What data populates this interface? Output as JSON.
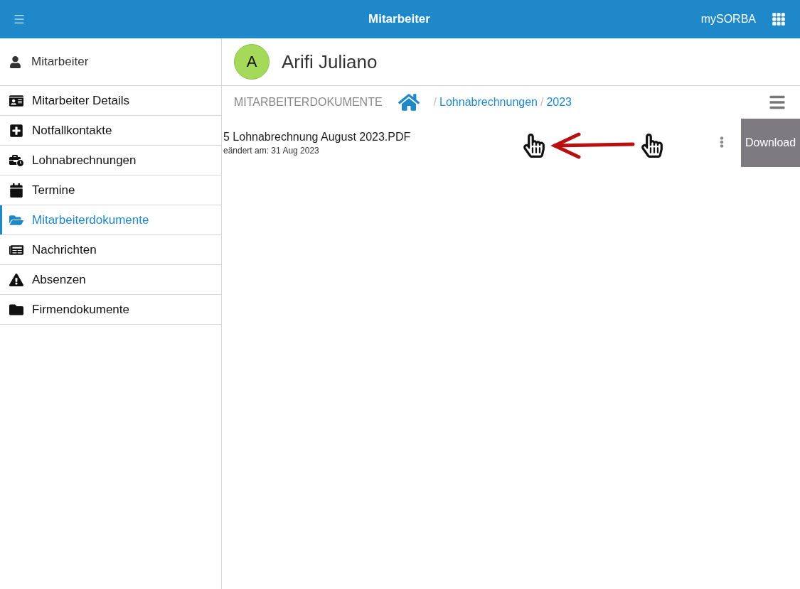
{
  "top_bar": {
    "title": "Mitarbeiter",
    "brand": "mySORBA"
  },
  "sidebar": {
    "header": "Mitarbeiter",
    "items": [
      {
        "label": "Mitarbeiter Details",
        "selected": false
      },
      {
        "label": "Notfallkontakte",
        "selected": false
      },
      {
        "label": "Lohnabrechnungen",
        "selected": false
      },
      {
        "label": "Termine",
        "selected": false
      },
      {
        "label": "Mitarbeiterdokumente",
        "selected": true
      },
      {
        "label": "Nachrichten",
        "selected": false
      },
      {
        "label": "Absenzen",
        "selected": false
      },
      {
        "label": "Firmendokumente",
        "selected": false
      }
    ]
  },
  "employee": {
    "initial": "A",
    "name": "Arifi Juliano"
  },
  "breadcrumb": {
    "section": "MITARBEITERDOKUMENTE",
    "crumbs": [
      {
        "separator": "/",
        "label": "Lohnabrechnungen"
      },
      {
        "separator": "/",
        "label": "2023"
      }
    ]
  },
  "documents": [
    {
      "name": "5 Lohnabrechnung August 2023.PDF",
      "modified": "eändert am: 31 Aug 2023",
      "action": "Download"
    }
  ]
}
